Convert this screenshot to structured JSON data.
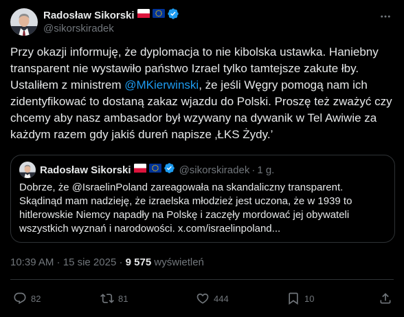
{
  "author": {
    "name": "Radosław Sikorski",
    "handle": "@sikorskiradek"
  },
  "post": {
    "text_before_mention": "Przy okazji informuję, że dyplomacja to nie kibolska ustawka. Haniebny transparent nie wystawiło państwo Izrael tylko tamtejsze zakute łby. Ustaliłem  z ministrem ",
    "mention": "@MKierwinski",
    "text_after_mention": ", że jeśli Węgry pomogą nam ich zidentyfikować to dostaną zakaz wjazdu do Polski.  Proszę też zważyć czy chcemy aby nasz ambasador był wzywany na dywanik w Tel Awiwie za każdym razem gdy jakiś dureń napisze ‚ŁKS Żydy.’"
  },
  "quote": {
    "name": "Radosław Sikorski",
    "handle": "@sikorskiradek",
    "separator": "·",
    "time": "1 g.",
    "text": "Dobrze, że @IsraelinPoland zareagowała na skandaliczny transparent. Skądinąd mam nadzieję, że izraelska młodzież jest uczona, że w 1939 to hitlerowskie Niemcy napadły na Polskę i zaczęły mordować jej obywateli wszystkich wyznań i narodowości. x.com/israelinpoland..."
  },
  "meta": {
    "time": "10:39 AM",
    "sep1": " · ",
    "date": "15 sie 2025",
    "sep2": " · ",
    "views": "9 575",
    "views_label": " wyświetleń"
  },
  "actions": {
    "replies": "82",
    "reposts": "81",
    "likes": "444",
    "bookmarks": "10"
  },
  "colors": {
    "background": "#000000",
    "text": "#e7e9ea",
    "muted": "#71767b",
    "accent": "#1d9bf0",
    "border": "#2f3336"
  },
  "icons": {
    "author_flags": [
      "poland-flag-icon",
      "eu-flag-icon"
    ],
    "verified": "verified-badge-icon",
    "more": "more-icon",
    "reply": "reply-icon",
    "repost": "repost-icon",
    "like": "heart-icon",
    "bookmark": "bookmark-icon",
    "share": "share-icon"
  }
}
